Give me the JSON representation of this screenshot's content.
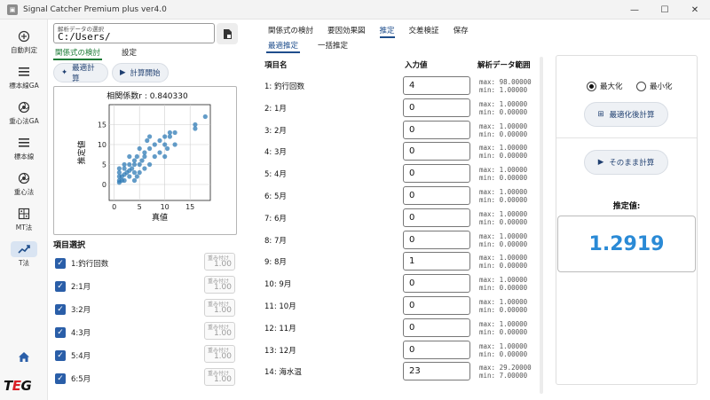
{
  "window": {
    "title": "Signal Catcher Premium plus ver4.0",
    "controls": [
      "—",
      "☐",
      "✕"
    ]
  },
  "sidebar": {
    "items": [
      {
        "label": "自動判定",
        "icon": "crosshair-plus-icon"
      },
      {
        "label": "標本線GA",
        "icon": "list-icon"
      },
      {
        "label": "重心法GA",
        "icon": "aperture-icon"
      },
      {
        "label": "標本線",
        "icon": "list-icon"
      },
      {
        "label": "重心法",
        "icon": "aperture-icon"
      },
      {
        "label": "MT法",
        "icon": "grid-icon"
      },
      {
        "label": "T法",
        "icon": "trend-icon"
      }
    ],
    "logo_text": "TEG"
  },
  "left": {
    "path_label": "解析データの選択",
    "path_value": "C:/Users/",
    "tabs": [
      "関係式の検討",
      "設定"
    ],
    "buttons": {
      "optimal": "最適計算",
      "start": "計算開始"
    },
    "chart_title": "相関係数r : 0.840330",
    "items_title": "項目選択",
    "items": [
      {
        "name": "1:釣行回数",
        "weight_label": "重み付け",
        "weight": "1.00"
      },
      {
        "name": "2:1月",
        "weight_label": "重み付け",
        "weight": "1.00"
      },
      {
        "name": "3:2月",
        "weight_label": "重み付け",
        "weight": "1.00"
      },
      {
        "name": "4:3月",
        "weight_label": "重み付け",
        "weight": "1.00"
      },
      {
        "name": "5:4月",
        "weight_label": "重み付け",
        "weight": "1.00"
      },
      {
        "name": "6:5月",
        "weight_label": "重み付け",
        "weight": "1.00"
      }
    ]
  },
  "chart_data": {
    "type": "scatter",
    "title": "相関係数r : 0.840330",
    "xlabel": "真値",
    "ylabel": "推定値",
    "xlim": [
      -1,
      19
    ],
    "ylim": [
      -4,
      20
    ],
    "xticks": [
      0,
      5,
      10,
      15
    ],
    "yticks": [
      0,
      5,
      10,
      15
    ],
    "grid": true,
    "points": [
      [
        1,
        1
      ],
      [
        1,
        2
      ],
      [
        1,
        0.5
      ],
      [
        1,
        3
      ],
      [
        1,
        4
      ],
      [
        1.5,
        1
      ],
      [
        1.5,
        2
      ],
      [
        2,
        1
      ],
      [
        2,
        2.5
      ],
      [
        2,
        4
      ],
      [
        2,
        5
      ],
      [
        2.5,
        3
      ],
      [
        3,
        2
      ],
      [
        3,
        3.5
      ],
      [
        3,
        5
      ],
      [
        3,
        7
      ],
      [
        3.5,
        4
      ],
      [
        4,
        1
      ],
      [
        4,
        3
      ],
      [
        4,
        5
      ],
      [
        4,
        6
      ],
      [
        4.5,
        2
      ],
      [
        4.5,
        7
      ],
      [
        5,
        3
      ],
      [
        5,
        5
      ],
      [
        5,
        9
      ],
      [
        5.5,
        6
      ],
      [
        6,
        4
      ],
      [
        6,
        7
      ],
      [
        6,
        8
      ],
      [
        6.5,
        11
      ],
      [
        7,
        5
      ],
      [
        7,
        9
      ],
      [
        7,
        12
      ],
      [
        8,
        7
      ],
      [
        8,
        10
      ],
      [
        9,
        8
      ],
      [
        9,
        11
      ],
      [
        10,
        7
      ],
      [
        10,
        10
      ],
      [
        10,
        12
      ],
      [
        10.5,
        9
      ],
      [
        11,
        12
      ],
      [
        11,
        13
      ],
      [
        12,
        10
      ],
      [
        12,
        13
      ],
      [
        16,
        14
      ],
      [
        16,
        15
      ],
      [
        18,
        17
      ]
    ]
  },
  "main": {
    "tabs": [
      "関係式の検討",
      "要因効果図",
      "推定",
      "交差検証",
      "保存"
    ],
    "active_tab": 2,
    "subtabs": [
      "最適推定",
      "一括推定"
    ],
    "headers": {
      "name": "項目名",
      "input": "入力値",
      "range": "解析データ範囲"
    },
    "rows": [
      {
        "name": "1: 釣行回数",
        "value": "4",
        "max": "max: 98.00000",
        "min": "min: 1.00000"
      },
      {
        "name": "2: 1月",
        "value": "0",
        "max": "max: 1.00000",
        "min": "min: 0.00000"
      },
      {
        "name": "3: 2月",
        "value": "0",
        "max": "max: 1.00000",
        "min": "min: 0.00000"
      },
      {
        "name": "4: 3月",
        "value": "0",
        "max": "max: 1.00000",
        "min": "min: 0.00000"
      },
      {
        "name": "5: 4月",
        "value": "0",
        "max": "max: 1.00000",
        "min": "min: 0.00000"
      },
      {
        "name": "6: 5月",
        "value": "0",
        "max": "max: 1.00000",
        "min": "min: 0.00000"
      },
      {
        "name": "7: 6月",
        "value": "0",
        "max": "max: 1.00000",
        "min": "min: 0.00000"
      },
      {
        "name": "8: 7月",
        "value": "0",
        "max": "max: 1.00000",
        "min": "min: 0.00000"
      },
      {
        "name": "9: 8月",
        "value": "1",
        "max": "max: 1.00000",
        "min": "min: 0.00000"
      },
      {
        "name": "10: 9月",
        "value": "0",
        "max": "max: 1.00000",
        "min": "min: 0.00000"
      },
      {
        "name": "11: 10月",
        "value": "0",
        "max": "max: 1.00000",
        "min": "min: 0.00000"
      },
      {
        "name": "12: 11月",
        "value": "0",
        "max": "max: 1.00000",
        "min": "min: 0.00000"
      },
      {
        "name": "13: 12月",
        "value": "0",
        "max": "max: 1.00000",
        "min": "min: 0.00000"
      },
      {
        "name": "14: 海水温",
        "value": "23",
        "max": "max: 29.20000",
        "min": "min: 7.00000"
      }
    ]
  },
  "right": {
    "maximize": "最大化",
    "minimize": "最小化",
    "optimize_btn": "最適化後計算",
    "asis_btn": "そのまま計算",
    "estimate_label": "推定値:",
    "estimate_value": "1.2919",
    "accent": "#2a8ad6"
  }
}
